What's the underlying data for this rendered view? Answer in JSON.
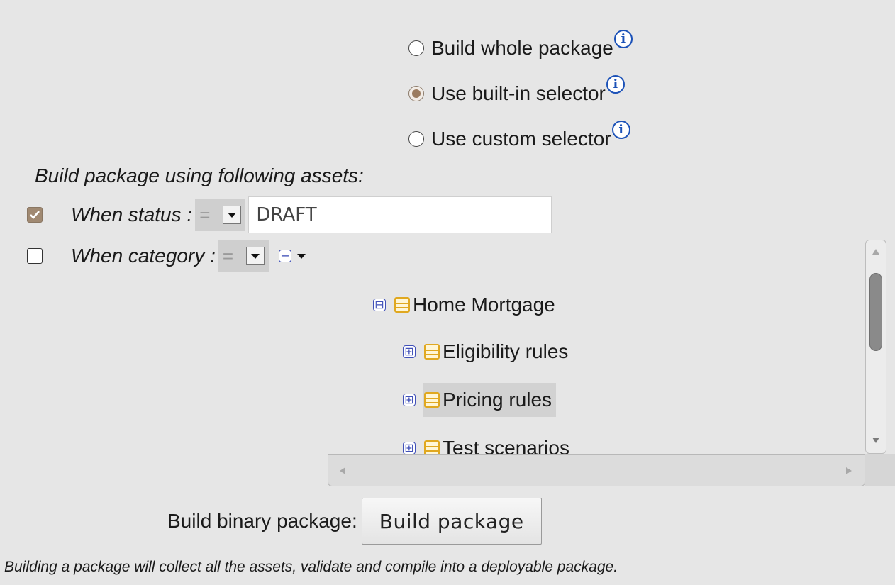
{
  "selector": {
    "options": [
      {
        "label": "Build whole package",
        "checked": false
      },
      {
        "label": "Use built-in selector",
        "checked": true
      },
      {
        "label": "Use custom selector",
        "checked": false
      }
    ],
    "info_icon_glyph": "i"
  },
  "assets": {
    "title": "Build package using following assets:",
    "status": {
      "checked": true,
      "label": "When status :",
      "operator": "=",
      "value": "DRAFT"
    },
    "category": {
      "checked": false,
      "label": "When category :",
      "operator": "="
    }
  },
  "tree": {
    "items": [
      {
        "label": "Home Mortgage",
        "expander": "⊟",
        "icon": "folder-icon"
      },
      {
        "label": "Eligibility rules",
        "expander": "⊞",
        "icon": "folder-icon"
      },
      {
        "label": "Pricing rules",
        "expander": "⊞",
        "icon": "folder-icon",
        "selected": true
      },
      {
        "label": "Test scenarios",
        "expander": "⊞",
        "icon": "folder-icon"
      }
    ]
  },
  "build": {
    "label": "Build binary package:",
    "button_label": "Build package",
    "note": "Building a package will collect all the assets, validate and compile into a deployable package."
  },
  "colors": {
    "background": "#e6e6e6",
    "info_blue": "#1c52b8",
    "expander_blue": "#4050b8",
    "folder_yellow": "#f0c030",
    "check_brown": "#a08972"
  }
}
